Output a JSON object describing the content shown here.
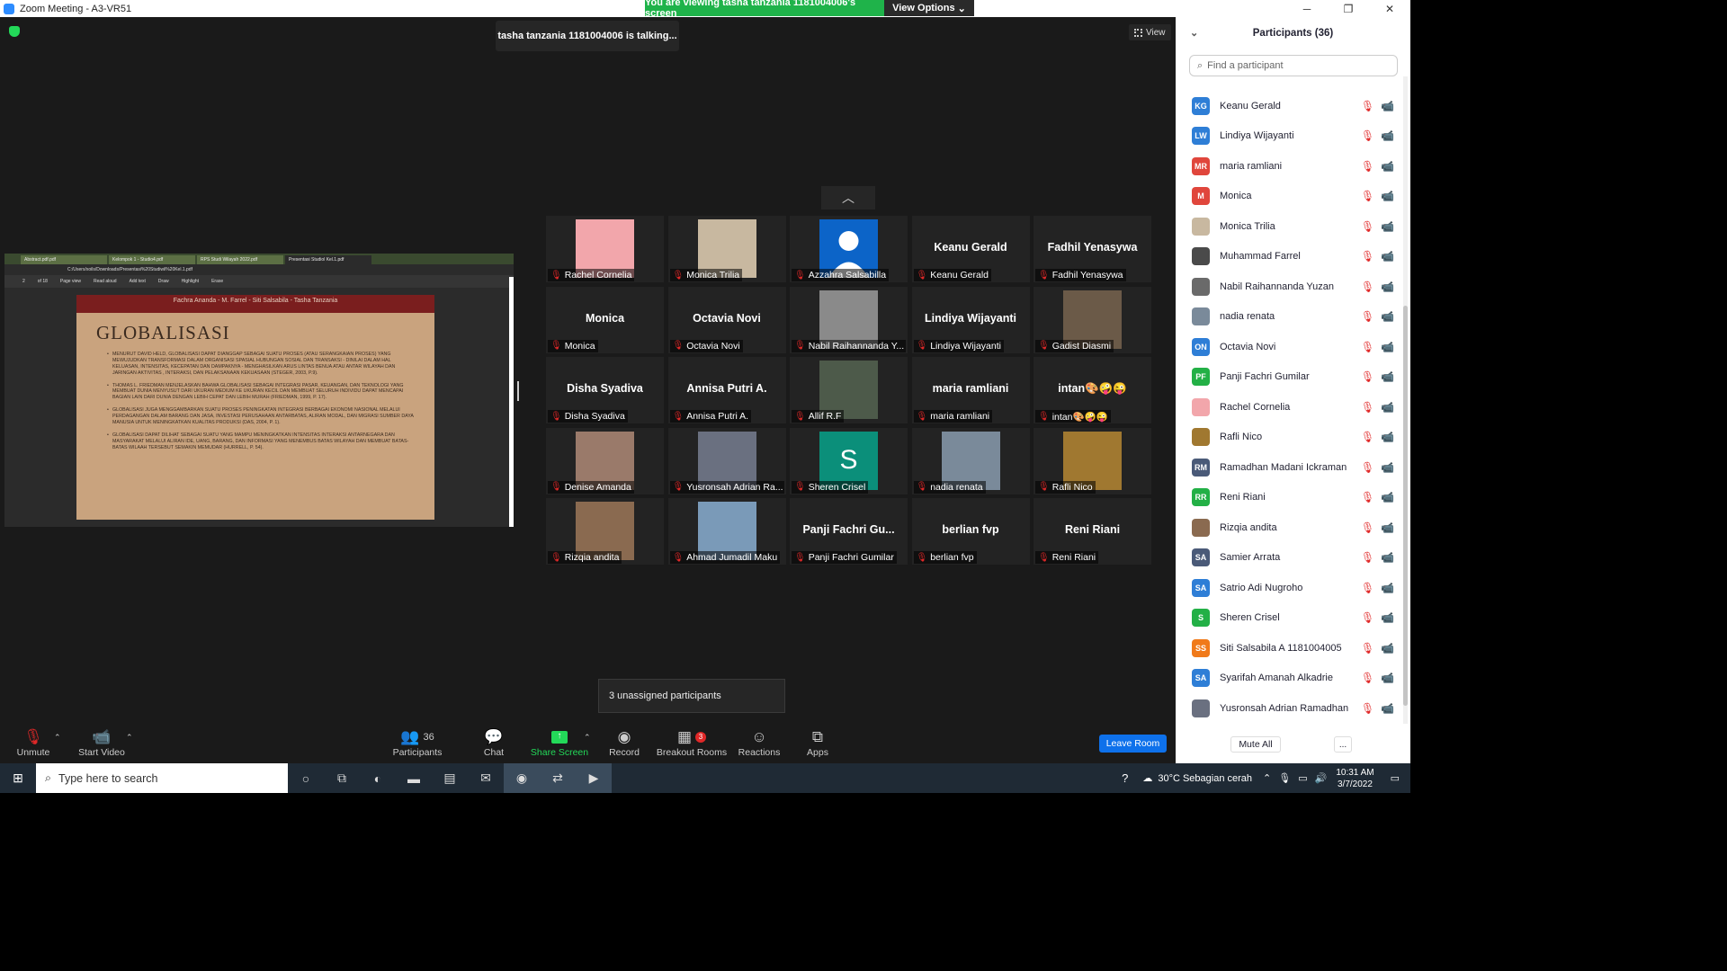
{
  "window": {
    "title": "Zoom Meeting - A3-VR51"
  },
  "banner": {
    "message": "You are viewing tasha tanzania 1181004006's screen",
    "view_options": "View Options"
  },
  "talking": "tasha tanzania 1181004006 is talking...",
  "view_button": "View",
  "shared_screen": {
    "tabs": [
      "Abstract.pdf.pdf",
      "Kelompok 1 - Studio4.pdf",
      "RPS Studi Wilayah 2022.pdf",
      "Presentasi Studiol Kel.1.pdf"
    ],
    "address": "C:/Users/xoils/Downloads/Presentasi%20Studiwil%20Kel.1.pdf",
    "page_number": "2",
    "page_of": "of 18",
    "tools": [
      "Page view",
      "Read aloud",
      "Add text",
      "Draw",
      "Highlight",
      "Erase"
    ],
    "slide_header": "Fachra Ananda - M. Farrel - Siti Salsabila - Tasha Tanzania",
    "slide_title": "GLOBALISASI",
    "bullets": [
      "MENURUT DAVID HELD, GLOBALISASI DAPAT DIANGGAP SEBAGAI SUATU PROSES (ATAU SERANGKAIAN PROSES) YANG MEWUJUDKAN TRANSFORMASI DALAM ORGANISASI SPASIAL HUBUNGAN SOSIAL DAN TRANSAKSI - DINILAI DALAM HAL KELUASAN, INTENSITAS, KECEPATAN DAN DAMPAKNYA - MENGHASILKAN ARUS LINTAS BENUA ATAU ANTAR WILAYAH DAN JARINGAN AKTIVITAS , INTERAKSI, DAN PELAKSANAAN KEKUASAAN (STEGER, 2003, P.9).",
      "THOMAS L. FRIEDMAN MENJELASKAN BAHWA GLOBALISASI SEBAGAI INTEGRASI PASAR, KEUANGAN, DAN TEKNOLOGI YANG MEMBUAT DUNIA MENYUSUT DARI UKURAN MEDIUM KE UKURAN KECIL DAN MEMBUAT SELURUH INDIVIDU DAPAT MENCAPAI BAGIAN LAIN DARI DUNIA DENGAN LEBIH CEPAT DAN LEBIH MURAH (FRIEDMAN, 1999, P. 17).",
      "GLOBALISASI JUGA MENGGAMBARKAN SUATU PROSES PENINGKATAN INTEGRASI BERBAGAI EKONOMI NASIONAL MELALUI PERDAGANGAN DALAM BARANG DAN JASA, INVESTASI PERUSAHAAN ANTARBATAS, ALIRAN MODAL, DAN MIGRASI SUMBER DAYA MANUSIA UNTUK MENINGKATKAN KUALITAS PRODUKSI (DAS, 2004, P. 1).",
      "GLOBALISASI DAPAT DILIHAT SEBAGAI SUATU YANG MAMPU MENINGKATKAN INTENSITAS INTERAKSI ANTARNEGARA DAN MASYARAKAT MELALUI ALIRAN IDE, UANG, BARANG, DAN INFORMASI YANG MENEMBUS BATAS WILAYAH DAN MEMBUAT BATAS-BATAS WILAAH TERSEBUT SEMAKIN MEMUDAR (HURRELL, P. 54)."
    ]
  },
  "gallery": [
    {
      "label": "Rachel Cornelia",
      "center": "",
      "thumb": "#f2a6ab"
    },
    {
      "label": "Monica Trilia",
      "center": "",
      "thumb": "#c8b8a0"
    },
    {
      "label": "Azzahra Salsabilla",
      "center": "",
      "thumb": "#0c64c8"
    },
    {
      "label": "Keanu Gerald",
      "center": "Keanu Gerald",
      "thumb": ""
    },
    {
      "label": "Fadhil Yenasywa",
      "center": "Fadhil Yenasywa",
      "thumb": ""
    },
    {
      "label": "Monica",
      "center": "Monica",
      "thumb": ""
    },
    {
      "label": "Octavia Novi",
      "center": "Octavia Novi",
      "thumb": ""
    },
    {
      "label": "Nabil Raihannanda Y...",
      "center": "",
      "thumb": "#8a8a8a"
    },
    {
      "label": "Lindiya Wijayanti",
      "center": "Lindiya Wijayanti",
      "thumb": ""
    },
    {
      "label": "Gadist Diasmi",
      "center": "",
      "thumb": "#6b5a48"
    },
    {
      "label": "Disha Syadiva",
      "center": "Disha Syadiva",
      "thumb": ""
    },
    {
      "label": "Annisa Putri A.",
      "center": "Annisa Putri A.",
      "thumb": ""
    },
    {
      "label": "Allif R.F",
      "center": "",
      "thumb": "#4d5a4a"
    },
    {
      "label": "maria ramliani",
      "center": "maria ramliani",
      "thumb": ""
    },
    {
      "label": "intan🎨🤪😜",
      "center": "intan🎨🤪😜",
      "thumb": ""
    },
    {
      "label": "Denise Amanda",
      "center": "",
      "thumb": "#9a7a6a"
    },
    {
      "label": "Yusronsah Adrian Ra...",
      "center": "",
      "thumb": "#6a7080"
    },
    {
      "label": "Sheren Crisel",
      "center": "",
      "thumb": "#0b8f7a"
    },
    {
      "label": "nadia renata",
      "center": "",
      "thumb": "#7a8a9a"
    },
    {
      "label": "Rafli Nico",
      "center": "",
      "thumb": "#a07830"
    },
    {
      "label": "Rizqia andita",
      "center": "",
      "thumb": "#8a6a50"
    },
    {
      "label": "Ahmad Jumadil Maku",
      "center": "",
      "thumb": "#7a9ab8"
    },
    {
      "label": "Panji Fachri Gumilar",
      "center": "Panji Fachri Gu...",
      "thumb": ""
    },
    {
      "label": "berlian fvp",
      "center": "berlian fvp",
      "thumb": ""
    },
    {
      "label": "Reni Riani",
      "center": "Reni Riani",
      "thumb": ""
    }
  ],
  "sheren_initial": "S",
  "unassigned": "3 unassigned participants",
  "toolbar": {
    "unmute": "Unmute",
    "start_video": "Start Video",
    "participants": "Participants",
    "participants_count": "36",
    "chat": "Chat",
    "share_screen": "Share Screen",
    "record": "Record",
    "breakout_rooms": "Breakout Rooms",
    "breakout_badge": "3",
    "reactions": "Reactions",
    "apps": "Apps",
    "leave": "Leave Room"
  },
  "panel": {
    "title": "Participants (36)",
    "search_placeholder": "Find a participant",
    "mute_all": "Mute All",
    "more": "...",
    "participants": [
      {
        "initials": "KG",
        "name": "Keanu Gerald",
        "color": "#2e7ed6",
        "video": false
      },
      {
        "initials": "LW",
        "name": "Lindiya Wijayanti",
        "color": "#2e7ed6",
        "video": false
      },
      {
        "initials": "MR",
        "name": "maria ramliani",
        "color": "#e0463c",
        "video": false
      },
      {
        "initials": "M",
        "name": "Monica",
        "color": "#e0463c",
        "video": false
      },
      {
        "initials": "",
        "name": "Monica Trilia",
        "color": "#c8b8a0",
        "video": false
      },
      {
        "initials": "",
        "name": "Muhammad Farrel",
        "color": "#4a4a4a",
        "video": true
      },
      {
        "initials": "",
        "name": "Nabil Raihannanda Yuzan",
        "color": "#6a6a6a",
        "video": false
      },
      {
        "initials": "",
        "name": "nadia renata",
        "color": "#7a8a9a",
        "video": false
      },
      {
        "initials": "ON",
        "name": "Octavia Novi",
        "color": "#2e7ed6",
        "video": false
      },
      {
        "initials": "PF",
        "name": "Panji Fachri Gumilar",
        "color": "#23b046",
        "video": false
      },
      {
        "initials": "",
        "name": "Rachel Cornelia",
        "color": "#f2a6ab",
        "video": false
      },
      {
        "initials": "",
        "name": "Rafli Nico",
        "color": "#a07830",
        "video": false
      },
      {
        "initials": "RM",
        "name": "Ramadhan Madani Ickraman",
        "color": "#4a5a78",
        "video": false
      },
      {
        "initials": "RR",
        "name": "Reni Riani",
        "color": "#23b046",
        "video": false
      },
      {
        "initials": "",
        "name": "Rizqia andita",
        "color": "#8a6a50",
        "video": false
      },
      {
        "initials": "SA",
        "name": "Samier Arrata",
        "color": "#4a5a78",
        "video": false
      },
      {
        "initials": "SA",
        "name": "Satrio Adi Nugroho",
        "color": "#2e7ed6",
        "video": false
      },
      {
        "initials": "S",
        "name": "Sheren Crisel",
        "color": "#23b046",
        "video": false
      },
      {
        "initials": "SS",
        "name": "Siti Salsabila A 1181004005",
        "color": "#f07a1a",
        "video": true
      },
      {
        "initials": "SA",
        "name": "Syarifah Amanah Alkadrie",
        "color": "#2e7ed6",
        "video": false
      },
      {
        "initials": "",
        "name": "Yusronsah Adrian Ramadhan",
        "color": "#6a7080",
        "video": false
      }
    ]
  },
  "taskbar": {
    "search_placeholder": "Type here to search",
    "weather": "30°C  Sebagian cerah",
    "time": "10:31 AM",
    "date": "3/7/2022"
  }
}
